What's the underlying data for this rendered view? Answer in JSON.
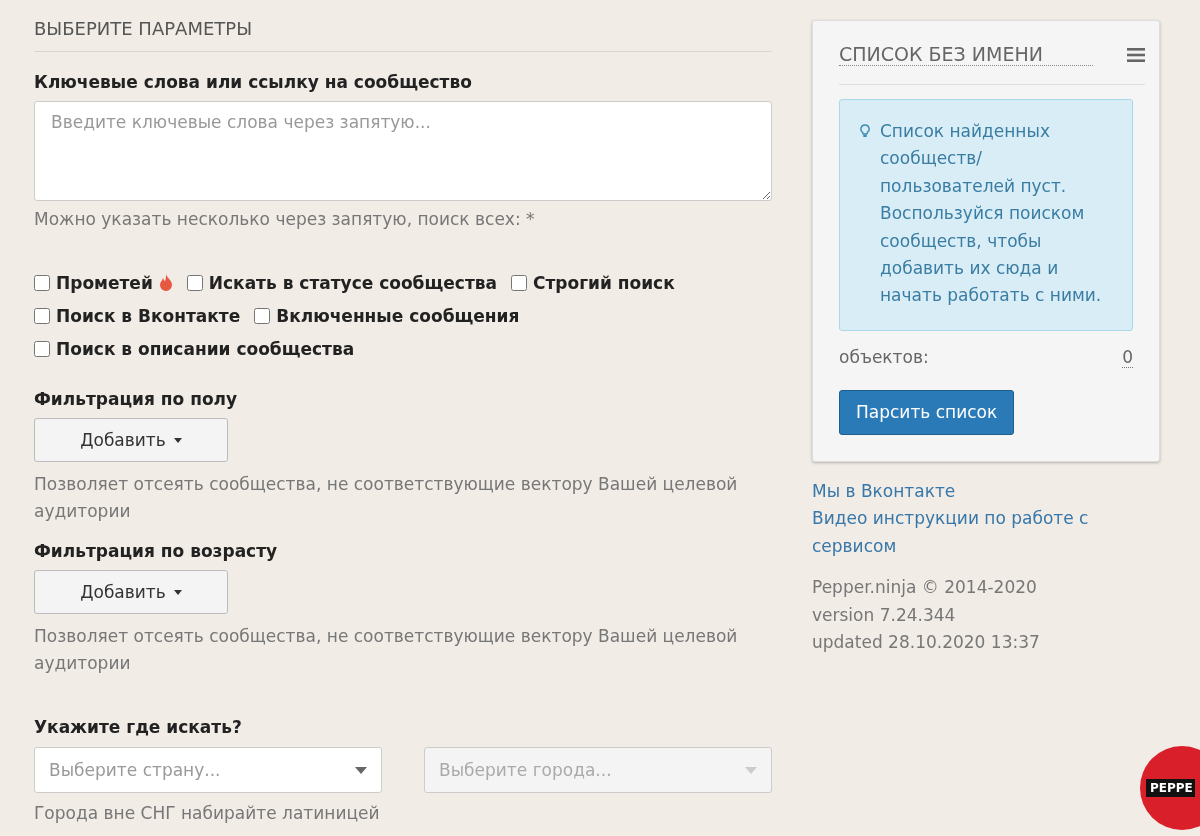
{
  "section_title": "ВЫБЕРИТЕ ПАРАМЕТРЫ",
  "keywords": {
    "label": "Ключевые слова или ссылку на сообщество",
    "placeholder": "Введите ключевые слова через запятую...",
    "hint": "Можно указать несколько через запятую, поиск всех: *"
  },
  "option_rows": [
    [
      {
        "label": "Прометей",
        "checked": false,
        "flame": true
      },
      {
        "label": "Искать в статусе сообщества",
        "checked": false,
        "flame": false
      },
      {
        "label": "Строгий поиск",
        "checked": false,
        "flame": false
      }
    ],
    [
      {
        "label": "Поиск в Вконтакте",
        "checked": false,
        "flame": false
      },
      {
        "label": "Включенные сообщения",
        "checked": false,
        "flame": false
      }
    ],
    [
      {
        "label": "Поиск в описании сообщества",
        "checked": false,
        "flame": false
      }
    ]
  ],
  "filters": [
    {
      "label": "Фильтрация по полу",
      "button": "Добавить",
      "hint": "Позволяет отсеять сообщества, не соответствующие вектору Вашей целевой аудитории"
    },
    {
      "label": "Фильтрация по возрасту",
      "button": "Добавить",
      "hint": "Позволяет отсеять сообщества, не соответствующие вектору Вашей целевой аудитории"
    }
  ],
  "location": {
    "label": "Укажите где искать?",
    "selects": [
      {
        "placeholder": "Выберите страну...",
        "disabled": false
      },
      {
        "placeholder": "Выберите города...",
        "disabled": true
      }
    ],
    "hint": "Города вне СНГ набирайте латиницей"
  },
  "list_panel": {
    "title": "СПИСОК БЕЗ ИМЕНИ",
    "info": "Список найденных сообществ/ пользователей пуст. Воспользуйся поиском сообществ, чтобы добавить их сюда и начать работать с ними.",
    "count_label": "объектов:",
    "count": "0",
    "button": "Парсить список"
  },
  "links": [
    "Мы в Вконтакте",
    "Видео инструкции по работе с сервисом"
  ],
  "footer": [
    "Pepper.ninja © 2014-2020",
    "version 7.24.344",
    "updated 28.10.2020 13:37"
  ],
  "badge": "PEPPE"
}
